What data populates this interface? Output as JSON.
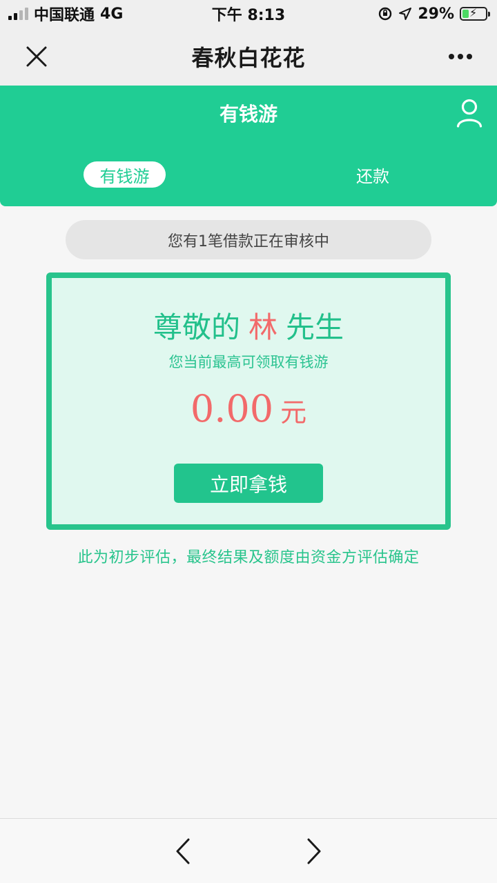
{
  "status_bar": {
    "carrier": "中国联通",
    "network": "4G",
    "time": "下午 8:13",
    "battery": "29%",
    "battery_level": 0.29
  },
  "title_bar": {
    "title": "春秋白花花",
    "close_icon": "close-icon",
    "more_icon": "more-dots-icon"
  },
  "header": {
    "title": "有钱游",
    "user_icon": "user-icon",
    "tabs": [
      {
        "label": "有钱游",
        "active": true
      },
      {
        "label": "还款",
        "active": false
      }
    ]
  },
  "notice": {
    "text": "您有1笔借款正在审核中"
  },
  "card": {
    "greeting_prefix": "尊敬的",
    "surname": "林",
    "honorific": "先生",
    "subtitle": "您当前最高可领取有钱游",
    "amount": "0.00",
    "currency": "元",
    "cta_label": "立即拿钱"
  },
  "disclaimer": "此为初步评估，最终结果及额度由资金方评估确定",
  "bottom_nav": {
    "back_icon": "chevron-left-icon",
    "forward_icon": "chevron-right-icon"
  },
  "colors": {
    "brand_green": "#20cd94",
    "accent_red": "#f26a6a",
    "card_bg": "#e0f8ef"
  }
}
